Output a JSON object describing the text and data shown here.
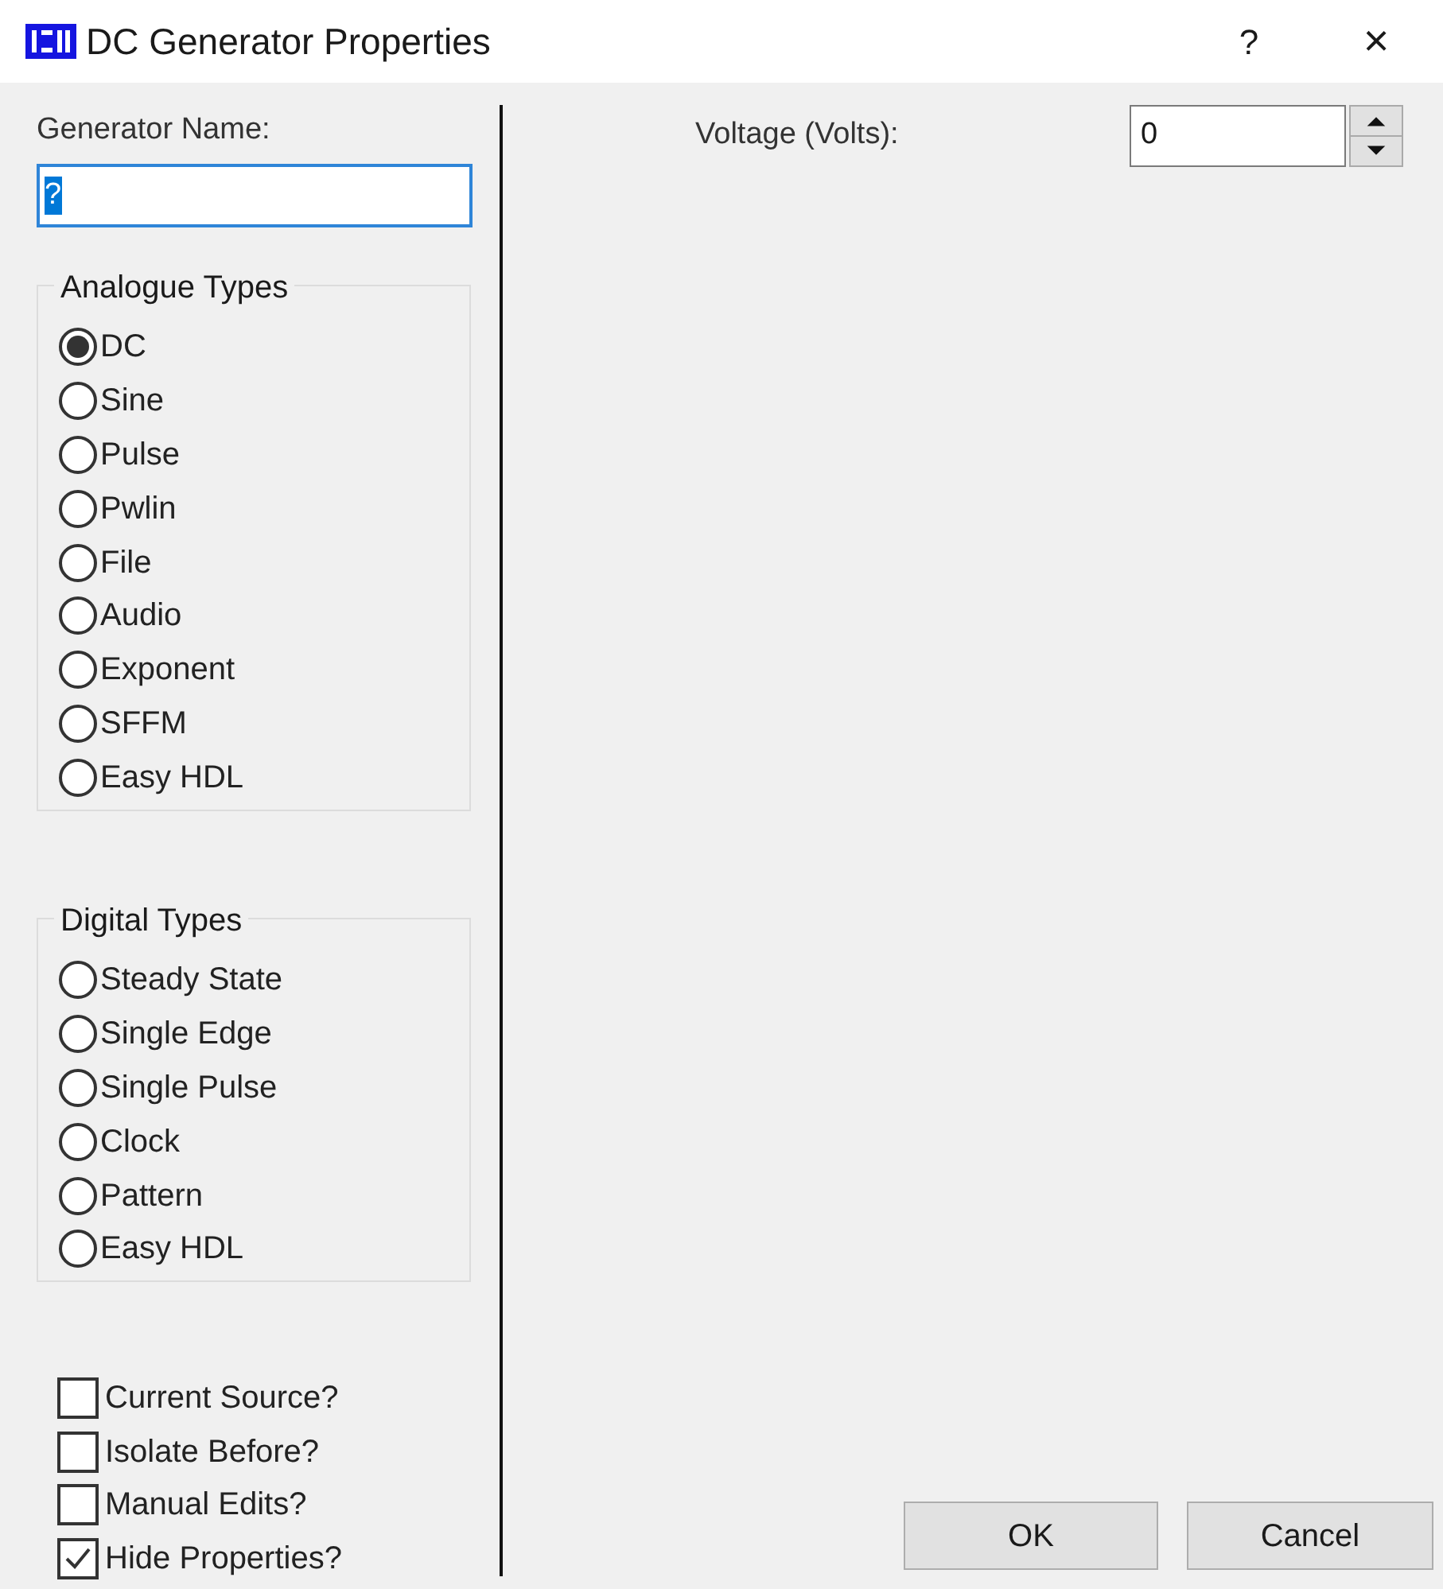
{
  "window": {
    "title": "DC Generator Properties",
    "help": "?",
    "close": "×"
  },
  "generator_name": {
    "label": "Generator Name:",
    "value": "?"
  },
  "analogue_types": {
    "title": "Analogue Types",
    "options": [
      {
        "label": "DC",
        "selected": true
      },
      {
        "label": "Sine",
        "selected": false
      },
      {
        "label": "Pulse",
        "selected": false
      },
      {
        "label": "Pwlin",
        "selected": false
      },
      {
        "label": "File",
        "selected": false
      },
      {
        "label": "Audio",
        "selected": false
      },
      {
        "label": "Exponent",
        "selected": false
      },
      {
        "label": "SFFM",
        "selected": false
      },
      {
        "label": "Easy HDL",
        "selected": false
      }
    ]
  },
  "digital_types": {
    "title": "Digital Types",
    "options": [
      {
        "label": "Steady State",
        "selected": false
      },
      {
        "label": "Single Edge",
        "selected": false
      },
      {
        "label": "Single Pulse",
        "selected": false
      },
      {
        "label": "Clock",
        "selected": false
      },
      {
        "label": "Pattern",
        "selected": false
      },
      {
        "label": "Easy HDL",
        "selected": false
      }
    ]
  },
  "options": [
    {
      "label": "Current Source?",
      "checked": false
    },
    {
      "label": "Isolate Before?",
      "checked": false
    },
    {
      "label": "Manual Edits?",
      "checked": false
    },
    {
      "label": "Hide Properties?",
      "checked": true
    }
  ],
  "voltage": {
    "label": "Voltage (Volts):",
    "value": "0"
  },
  "buttons": [
    "OK",
    "Cancel"
  ]
}
